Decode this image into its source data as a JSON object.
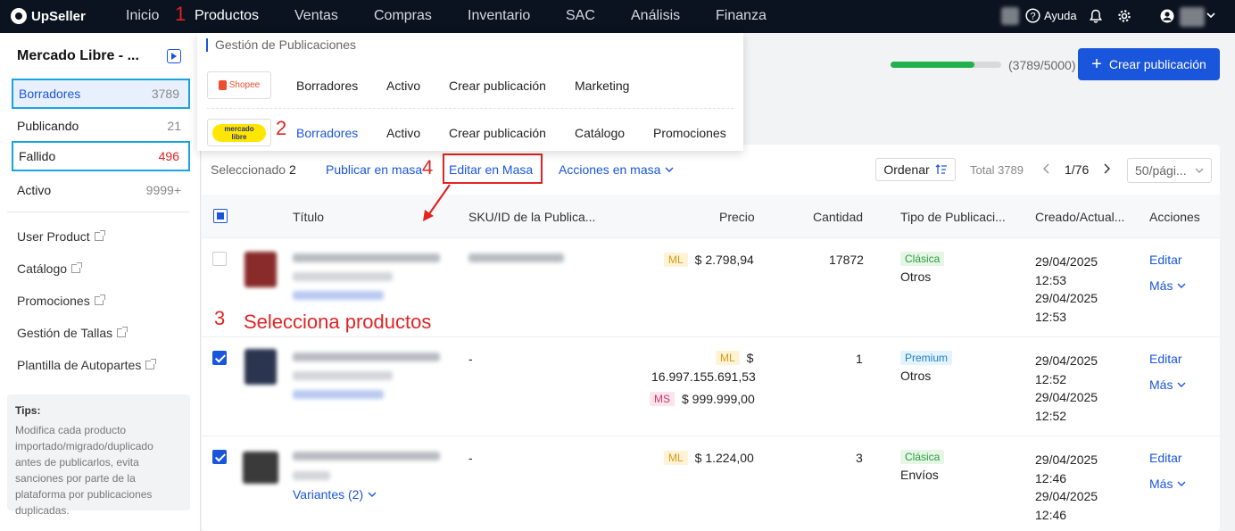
{
  "nav": {
    "logo": "UpSeller",
    "items": [
      "Inicio",
      "Productos",
      "Ventas",
      "Compras",
      "Inventario",
      "SAC",
      "Análisis",
      "Finanza"
    ],
    "help": "Ayuda"
  },
  "annotations": {
    "step1": "1",
    "step2": "2",
    "step3_num": "3",
    "step3_text": "Selecciona productos",
    "step4": "4"
  },
  "sidebar": {
    "store": "Mercado Libre - ...",
    "statuses": [
      {
        "label": "Borradores",
        "count": "3789"
      },
      {
        "label": "Publicando",
        "count": "21"
      },
      {
        "label": "Fallido",
        "count": "496"
      },
      {
        "label": "Activo",
        "count": "9999+"
      }
    ],
    "links": [
      "User Product",
      "Catálogo",
      "Promociones",
      "Gestión de Tallas",
      "Plantilla de Autopartes"
    ],
    "tips_title": "Tips:",
    "tips_body": "Modifica cada producto importado/migrado/duplicado antes de publicarlos, evita sanciones por parte de la plataforma por publicaciones duplicadas."
  },
  "dropdown": {
    "header": "Gestión de Publicaciones",
    "shopee": {
      "logo": "Shopee",
      "links": [
        "Borradores",
        "Activo",
        "Crear publicación",
        "Marketing"
      ]
    },
    "mercadolibre": {
      "logo_line1": "mercado",
      "logo_line2": "libre",
      "links": [
        "Borradores",
        "Activo",
        "Crear publicación",
        "Catálogo",
        "Promociones"
      ]
    }
  },
  "header": {
    "quota": "(3789/5000)",
    "quota_fraction": 0.758,
    "create": "Crear publicación"
  },
  "toolbar": {
    "selected_label": "Seleccionado",
    "selected_count": "2",
    "publish": "Publicar en masa",
    "edit": "Editar en Masa",
    "actions": "Acciones en masa",
    "sort": "Ordenar",
    "total": "Total 3789",
    "page": "1/76",
    "per_page": "50/pági..."
  },
  "table": {
    "headers": [
      "Título",
      "SKU/ID de la Publica...",
      "Precio",
      "Cantidad",
      "Tipo de Publicaci...",
      "Creado/Actual...",
      "Acciones"
    ],
    "rows": [
      {
        "sku": "",
        "price_tag": "ML",
        "price": "$ 2.798,94",
        "qty": "17872",
        "type": "Clásica",
        "shipping": "Otros",
        "dates": [
          "29/04/2025",
          "12:53",
          "29/04/2025",
          "12:53"
        ],
        "edit": "Editar",
        "more": "Más",
        "variants": ""
      },
      {
        "sku": "-",
        "price_tag": "ML",
        "price_line1": "$",
        "price_line2": "16.997.155.691,53",
        "price2_tag": "MS",
        "price2": "$ 999.999,00",
        "qty": "1",
        "type": "Premium",
        "shipping": "Otros",
        "dates": [
          "29/04/2025",
          "12:52",
          "29/04/2025",
          "12:52"
        ],
        "edit": "Editar",
        "more": "Más",
        "variants": ""
      },
      {
        "sku": "-",
        "price_tag": "ML",
        "price": "$ 1.224,00",
        "qty": "3",
        "type": "Clásica",
        "shipping": "Envíos",
        "dates": [
          "29/04/2025",
          "12:46",
          "29/04/2025",
          "12:46"
        ],
        "edit": "Editar",
        "more": "Más",
        "variants": "Variantes (2)"
      }
    ]
  }
}
